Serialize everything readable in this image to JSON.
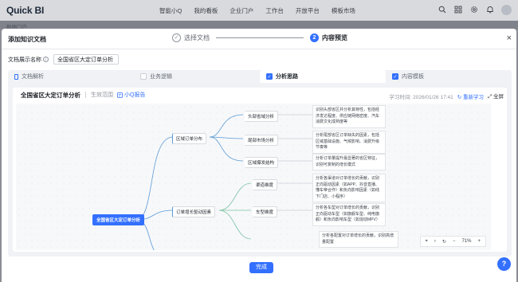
{
  "app": {
    "logo": "Quick BI"
  },
  "topnav": {
    "items": [
      "智能小Q",
      "我的看板",
      "企业门户",
      "工作台",
      "开放平台",
      "模板市场"
    ]
  },
  "topicons": [
    "search-icon",
    "apps-icon",
    "gear-icon",
    "bell-icon"
  ],
  "background": {
    "sidebar_text": "数据门户"
  },
  "modal": {
    "title": "添加知识文档",
    "close": "×",
    "steps": [
      {
        "index": "✓",
        "label": "选择文档",
        "state": "done"
      },
      {
        "index": "2",
        "label": "内容预览",
        "state": "active"
      }
    ],
    "name_label": "文档展示名称",
    "name_value": "全国省区大定订单分析",
    "finish_label": "完成"
  },
  "tabs": [
    {
      "label": "文档解析",
      "kind": "doc"
    },
    {
      "label": "业务逻辑",
      "kind": "check",
      "checked": false
    },
    {
      "label": "分析思路",
      "kind": "check",
      "checked": true
    },
    {
      "label": "内容模板",
      "kind": "check",
      "checked": true
    }
  ],
  "panel": {
    "title": "全国省区大定订单分析",
    "scope_label": "生效范围",
    "report_label": "小Q报告",
    "learn_time": "学习时间: 2026/01/26 17:41",
    "relearn_label": "重新学习",
    "fullscreen_label": "全屏"
  },
  "mindmap": {
    "root": "全国省区大定订单分析",
    "branches": [
      {
        "label": "区域订单分布"
      },
      {
        "label": "订单增长驱动因素"
      }
    ],
    "leaves": [
      {
        "label": "头部省域分析",
        "desc": "识别头部省区并分析其特性，包括经济发达程度、供应链网络密度、汽车消费文化成熟度等"
      },
      {
        "label": "尾部市场分析",
        "desc": "分析尾部省区订单缺失的因素，包括区域基础设施、气候影响、消费升级节奏等"
      },
      {
        "label": "区域爆发结构",
        "desc": "分析订单量提升最显著的省区特征，识别可复制的增长模式"
      },
      {
        "label": "渠道维度",
        "desc": "分析各渠道对订单增长的贡献，识别正向驱动因素（如APP、抖音直播、懂车帝合作）和负向影响因素（如线下门店、小程序）"
      },
      {
        "label": "车型维度",
        "desc": "分析各车型对订单增长的贡献，识别正向驱动车型（如旗舰车型、纯电旗舰）和负向影响车型（如混动MPV）"
      },
      {
        "label": "",
        "desc": "分析各配置对订单增长的贡献，识别高增量配置"
      }
    ]
  },
  "zoom": {
    "level": "71%",
    "minus": "−",
    "plus": "+"
  },
  "help": "?"
}
